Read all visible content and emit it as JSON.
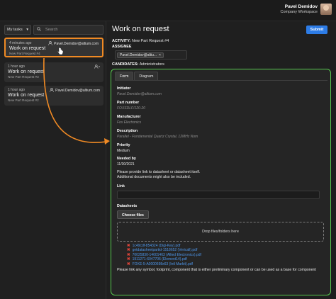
{
  "header": {
    "user_name": "Pavel Demidov",
    "workspace": "Company Workspace"
  },
  "sidebar": {
    "filter_label": "My tasks",
    "search_placeholder": "Search",
    "tasks": [
      {
        "time": "4 minutes ago",
        "title": "Work on request",
        "subtitle": "New Part Request #4",
        "assignee": "Pavel.Demidov@altium.com"
      },
      {
        "time": "1 hour ago",
        "title": "Work on request",
        "subtitle": "New Part Request #3",
        "assignee": ""
      },
      {
        "time": "1 hour ago",
        "title": "Work on request",
        "subtitle": "New Part Request #2",
        "assignee": "Pavel.Demidov@altium.com"
      }
    ]
  },
  "main": {
    "title": "Work on request",
    "submit_label": "Submit",
    "activity_label": "ACTIVITY:",
    "activity_value": "New Part Request #4",
    "assignee_label": "ASSIGNEE",
    "assignee_chip": "Pavel.Demidov@altiu...",
    "candidates_label": "CANDIDATES:",
    "candidates_value": "Administrators",
    "tabs": [
      "Form",
      "Diagram"
    ],
    "form": {
      "initiator_label": "Initiator",
      "initiator_value": "Pavel.Demidov@altium.com",
      "part_number_label": "Part number",
      "part_number_value": "FOXSDLF/120-20",
      "manufacturer_label": "Manufacturer",
      "manufacturer_value": "Fox Electronics",
      "description_label": "Description",
      "description_value": "Parallel - Fundamental Quartz Crystal, 12MHz Nom",
      "priority_label": "Priority",
      "priority_value": "Medium",
      "needed_by_label": "Needed by",
      "needed_by_value": "11/30/2021",
      "instructions_line1": "Please provide link to datasheet or datasheet itself.",
      "instructions_line2": "Additional documents might also be included.",
      "link_label": "Link",
      "datasheets_label": "Datasheets",
      "choose_files_label": "Choose files",
      "drop_text": "Drop files/folders here",
      "files": [
        "1c49cdf-854324 (Digi-Key).pdf",
        "getdatasheetpartid-1518652 (Vericall).pdf",
        "70025830-14601463 (Allied Electronics).pdf",
        "1911271-6047706 (Element14).pdf",
        "FOXE-5-A0000698x63 (Intl Markit).pdf"
      ],
      "note": "Please link any symbol, footprint, component that is either preliminary component or can be used as a base for component"
    }
  },
  "colors": {
    "accent_orange": "#f08a24",
    "accent_green": "#58c94f",
    "submit_blue": "#2d7ce6",
    "file_link": "#4d95e8"
  }
}
